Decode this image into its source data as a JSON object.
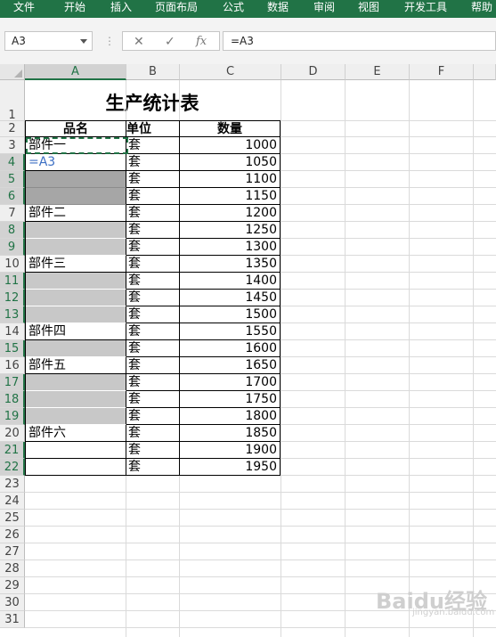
{
  "ribbon": {
    "tabs": [
      "文件",
      "开始",
      "插入",
      "页面布局",
      "公式",
      "数据",
      "审阅",
      "视图",
      "开发工具",
      "帮助"
    ],
    "color": "#217346"
  },
  "formula_bar": {
    "name_box": "A3",
    "cancel_icon": "✕",
    "enter_icon": "✓",
    "fx_label": "fx",
    "formula": "=A3"
  },
  "sheet": {
    "columns": [
      "A",
      "B",
      "C",
      "D",
      "E",
      "F"
    ],
    "selected_column": "A",
    "rows": [
      "1",
      "2",
      "3",
      "4",
      "5",
      "6",
      "7",
      "8",
      "9",
      "10",
      "11",
      "12",
      "13",
      "14",
      "15",
      "16",
      "17",
      "18",
      "19",
      "20",
      "21",
      "22",
      "23",
      "24",
      "25",
      "26",
      "27",
      "28",
      "29",
      "30",
      "31"
    ],
    "title": "生产统计表",
    "headers": [
      "品名",
      "单位",
      "数量"
    ],
    "table_rows": [
      {
        "name": "部件一",
        "unit": "套",
        "qty": "1000",
        "fill": "",
        "active": true
      },
      {
        "name": "=A3",
        "unit": "套",
        "qty": "1050",
        "fill": "",
        "editing": true
      },
      {
        "name": "",
        "unit": "套",
        "qty": "1100",
        "fill": "#a6a6a6"
      },
      {
        "name": "",
        "unit": "套",
        "qty": "1150",
        "fill": "#a6a6a6"
      },
      {
        "name": "部件二",
        "unit": "套",
        "qty": "1200",
        "fill": ""
      },
      {
        "name": "",
        "unit": "套",
        "qty": "1250",
        "fill": "#c8c8c8"
      },
      {
        "name": "",
        "unit": "套",
        "qty": "1300",
        "fill": "#c8c8c8"
      },
      {
        "name": "部件三",
        "unit": "套",
        "qty": "1350",
        "fill": ""
      },
      {
        "name": "",
        "unit": "套",
        "qty": "1400",
        "fill": "#c8c8c8"
      },
      {
        "name": "",
        "unit": "套",
        "qty": "1450",
        "fill": "#c8c8c8"
      },
      {
        "name": "",
        "unit": "套",
        "qty": "1500",
        "fill": "#c8c8c8"
      },
      {
        "name": "部件四",
        "unit": "套",
        "qty": "1550",
        "fill": ""
      },
      {
        "name": "",
        "unit": "套",
        "qty": "1600",
        "fill": "#c8c8c8"
      },
      {
        "name": "部件五",
        "unit": "套",
        "qty": "1650",
        "fill": ""
      },
      {
        "name": "",
        "unit": "套",
        "qty": "1700",
        "fill": "#c8c8c8"
      },
      {
        "name": "",
        "unit": "套",
        "qty": "1750",
        "fill": "#c8c8c8"
      },
      {
        "name": "",
        "unit": "套",
        "qty": "1800",
        "fill": "#c8c8c8"
      },
      {
        "name": "部件六",
        "unit": "套",
        "qty": "1850",
        "fill": ""
      },
      {
        "name": "",
        "unit": "套",
        "qty": "1900",
        "fill": ""
      },
      {
        "name": "",
        "unit": "套",
        "qty": "1950",
        "fill": ""
      }
    ],
    "selected_rows": [
      "4",
      "5",
      "6",
      "8",
      "9",
      "11",
      "12",
      "13",
      "15",
      "17",
      "18",
      "19",
      "21",
      "22"
    ]
  },
  "watermark": {
    "text": "Baidu经验",
    "sub": "jingyan.baidu.com"
  }
}
